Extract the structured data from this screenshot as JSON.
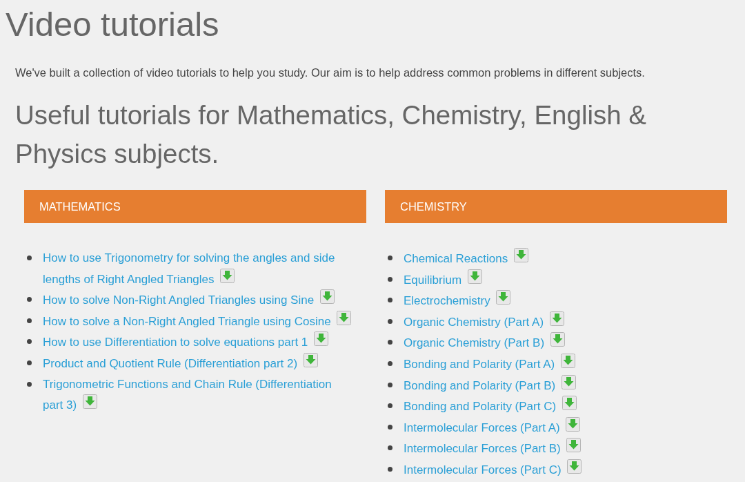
{
  "title": "Video tutorials",
  "intro": "We've built a collection of video tutorials to help you study. Our aim is to help address common problems in different subjects.",
  "subtitle": "Useful tutorials for Mathematics, Chemistry, English & Physics subjects.",
  "sections": [
    {
      "heading": "MATHEMATICS",
      "links": [
        "How to use Trigonometry for solving the angles and side lengths of Right Angled Triangles",
        "How to solve Non-Right Angled Triangles using Sine",
        "How to solve a Non-Right Angled Triangle using Cosine",
        "How to use Differentiation to solve equations part 1",
        "Product and Quotient Rule (Differentiation part 2)",
        "Trigonometric Functions and Chain Rule (Differentiation part 3)"
      ]
    },
    {
      "heading": "CHEMISTRY",
      "links": [
        "Chemical Reactions",
        "Equilibrium",
        "Electrochemistry",
        "Organic Chemistry (Part A)",
        "Organic Chemistry (Part B)",
        "Bonding and Polarity (Part A)",
        "Bonding and Polarity (Part B)",
        "Bonding and Polarity (Part C)",
        "Intermolecular Forces (Part A)",
        "Intermolecular Forces (Part B)",
        "Intermolecular Forces (Part C)"
      ]
    }
  ]
}
